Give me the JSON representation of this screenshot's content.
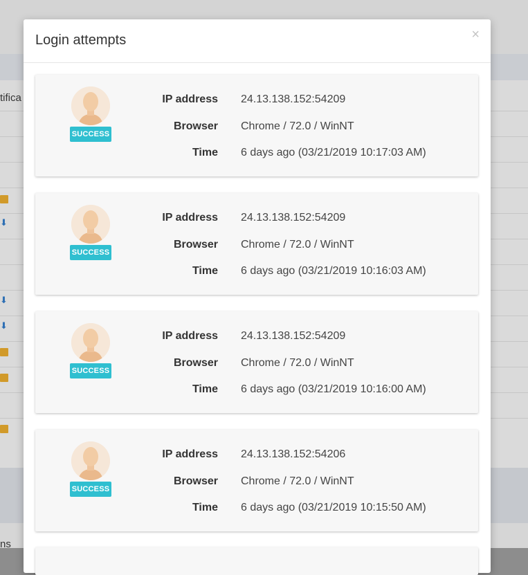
{
  "background": {
    "partial_column_text": "tifica",
    "bottom_partial_text": "ns"
  },
  "modal": {
    "title": "Login attempts",
    "close_label": "×"
  },
  "labels": {
    "ip": "IP address",
    "browser": "Browser",
    "time": "Time"
  },
  "attempts": [
    {
      "status": "SUCCESS",
      "ip": "24.13.138.152:54209",
      "browser": "Chrome / 72.0 / WinNT",
      "time": "6 days ago (03/21/2019 10:17:03 AM)"
    },
    {
      "status": "SUCCESS",
      "ip": "24.13.138.152:54209",
      "browser": "Chrome / 72.0 / WinNT",
      "time": "6 days ago (03/21/2019 10:16:03 AM)"
    },
    {
      "status": "SUCCESS",
      "ip": "24.13.138.152:54209",
      "browser": "Chrome / 72.0 / WinNT",
      "time": "6 days ago (03/21/2019 10:16:00 AM)"
    },
    {
      "status": "SUCCESS",
      "ip": "24.13.138.152:54206",
      "browser": "Chrome / 72.0 / WinNT",
      "time": "6 days ago (03/21/2019 10:15:50 AM)"
    }
  ],
  "colors": {
    "success_badge": "#2fbfd0",
    "card_bg": "#f7f7f7"
  }
}
